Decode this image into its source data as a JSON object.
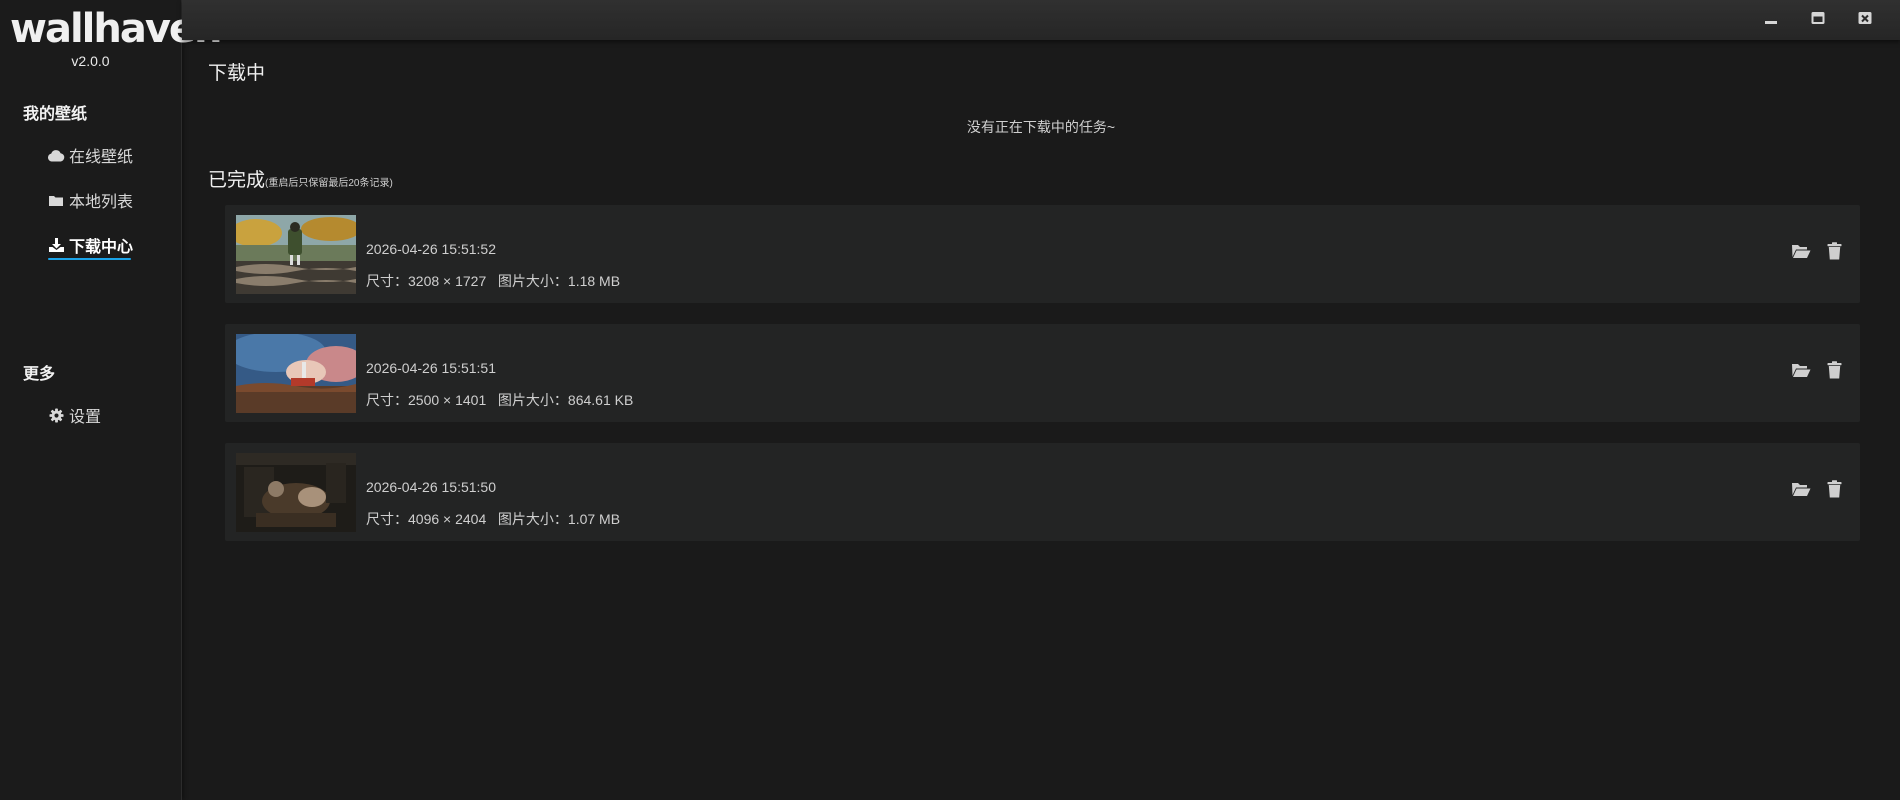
{
  "app": {
    "logo": "wallhaven",
    "version": "v2.0.0"
  },
  "sidebar": {
    "groups": [
      {
        "title": "我的壁纸",
        "items": [
          {
            "label": "在线壁纸",
            "icon": "cloud-icon"
          },
          {
            "label": "本地列表",
            "icon": "folder-icon"
          },
          {
            "label": "下载中心",
            "icon": "download-icon",
            "active": true
          }
        ]
      },
      {
        "title": "更多",
        "items": [
          {
            "label": "设置",
            "icon": "gear-icon"
          }
        ]
      }
    ]
  },
  "window_controls": [
    "minimize-icon",
    "maximize-icon",
    "close-icon"
  ],
  "downloading": {
    "title": "下载中",
    "empty_message": "没有正在下载中的任务~"
  },
  "completed": {
    "title": "已完成",
    "note": "(重启后只保留最后20条记录)",
    "size_label": "尺寸：",
    "filesize_label": "图片大小：",
    "items": [
      {
        "time": "2026-04-26 15:51:52",
        "dimensions": "3208 × 1727",
        "filesize": "1.18 MB"
      },
      {
        "time": "2026-04-26 15:51:51",
        "dimensions": "2500 × 1401",
        "filesize": "864.61 KB"
      },
      {
        "time": "2026-04-26 15:51:50",
        "dimensions": "4096 × 2404",
        "filesize": "1.07 MB"
      }
    ]
  },
  "colors": {
    "accent": "#1aa3e8",
    "background": "#1a1a1a",
    "card": "#232424",
    "text_muted": "#cfcfcf"
  }
}
